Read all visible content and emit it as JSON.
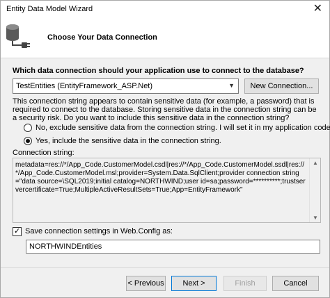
{
  "window": {
    "title": "Entity Data Model Wizard",
    "close_glyph": "✕"
  },
  "header": {
    "heading": "Choose Your Data Connection",
    "icon": "database-connection-icon"
  },
  "connection": {
    "question": "Which data connection should your application use to connect to the database?",
    "selected": "TestEntities (EntityFramework_ASP.Net)",
    "new_connection_label": "New Connection..."
  },
  "warning": "This connection string appears to contain sensitive data (for example, a password) that is required to connect to the database. Storing sensitive data in the connection string can be a security risk. Do you want to include this sensitive data in the connection string?",
  "options": {
    "exclude": {
      "label": "No, exclude sensitive data from the connection string. I will set it in my application code.",
      "checked": false
    },
    "include": {
      "label": "Yes, include the sensitive data in the connection string.",
      "checked": true
    }
  },
  "connection_string": {
    "label": "Connection string:",
    "value": "metadata=res://*/App_Code.CustomerModel.csdl|res://*/App_Code.CustomerModel.ssdl|res://*/App_Code.CustomerModel.msl;provider=System.Data.SqlClient;provider connection string=\"data source=\\SQL2019;initial catalog=NORTHWIND;user id=sa;password=**********;trustservercertificate=True;MultipleActiveResultSets=True;App=EntityFramework\""
  },
  "save": {
    "label": "Save connection settings in Web.Config as:",
    "checked": true,
    "entity_name": "NORTHWINDEntities"
  },
  "buttons": {
    "previous": "< Previous",
    "next": "Next >",
    "finish": "Finish",
    "cancel": "Cancel"
  }
}
